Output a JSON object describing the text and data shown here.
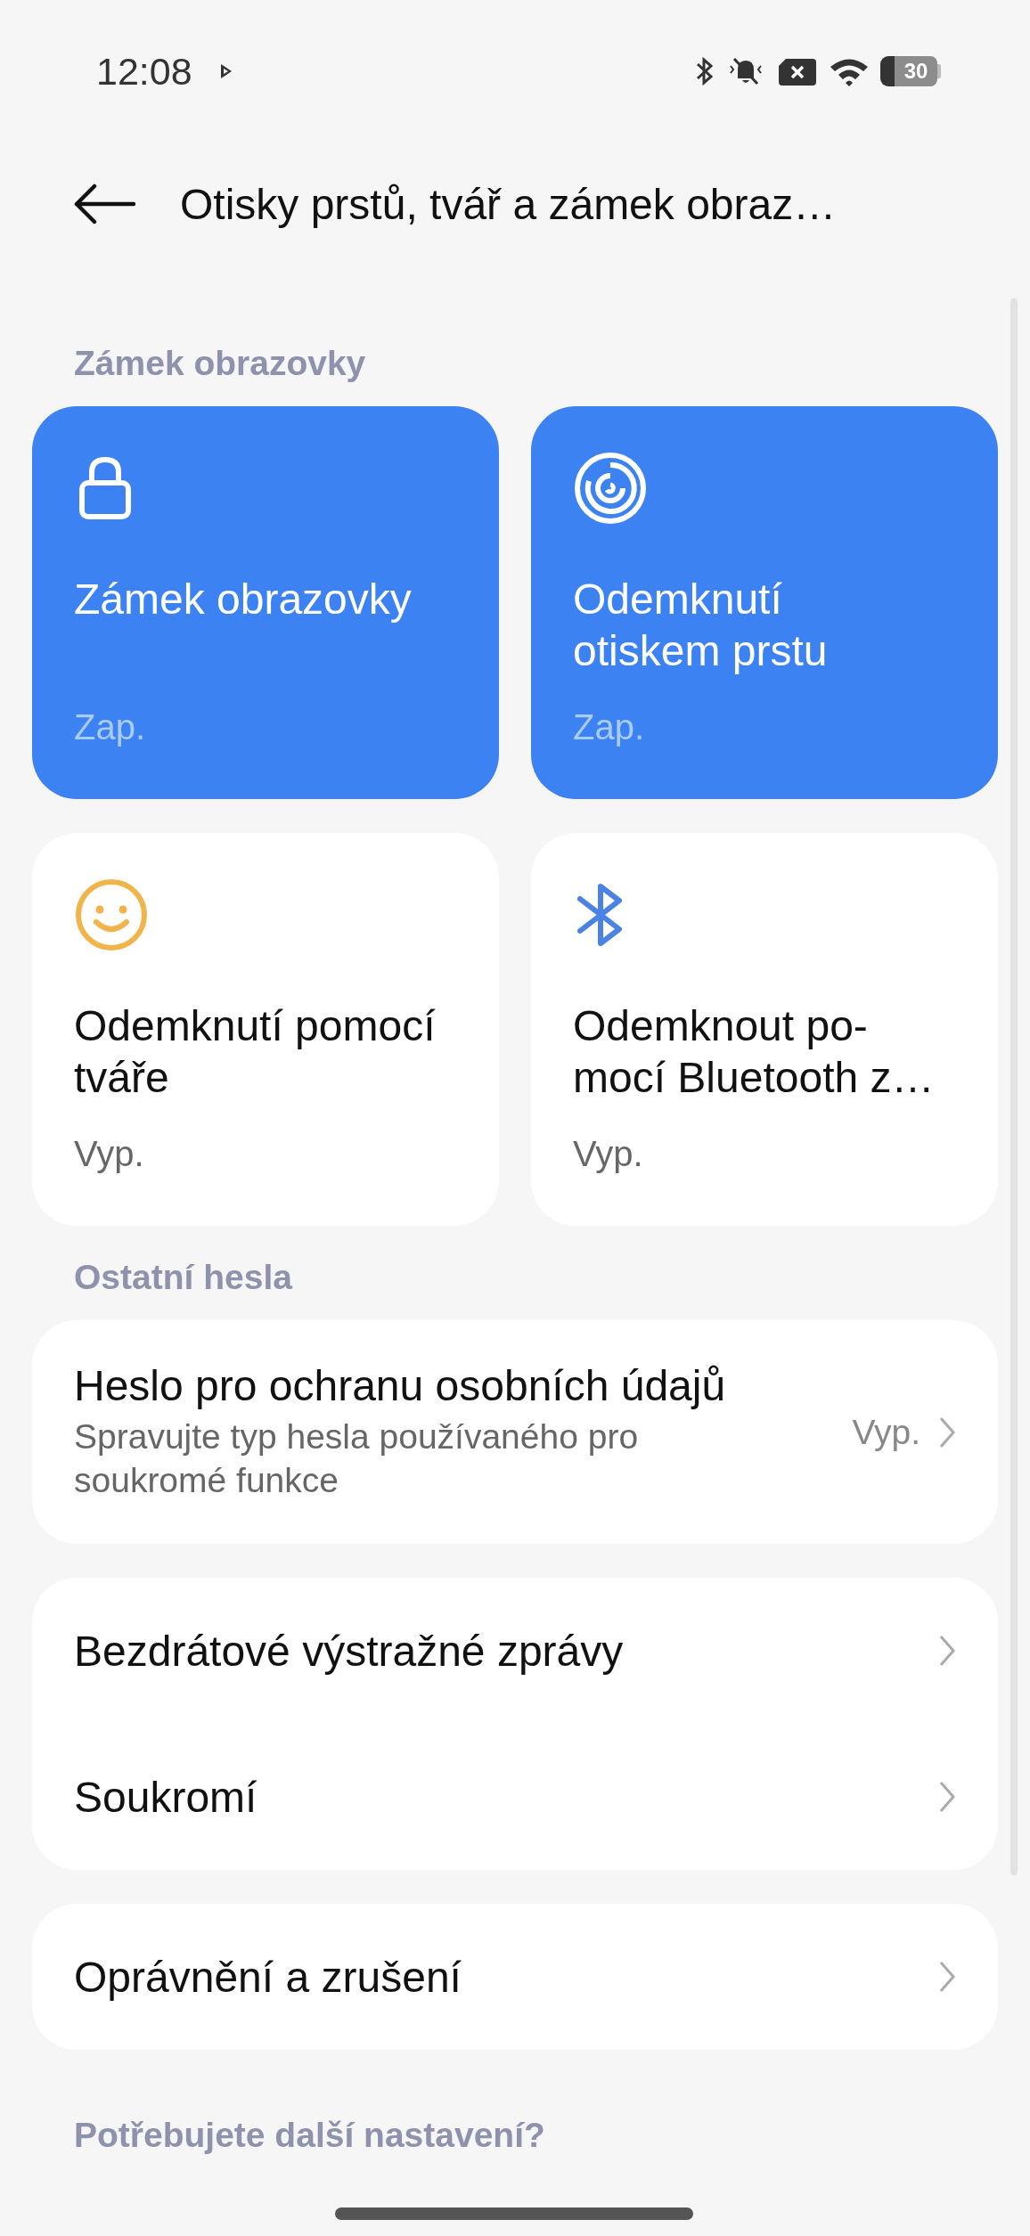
{
  "status_bar": {
    "time": "12:08",
    "battery": "30"
  },
  "header": {
    "title": "Otisky prstů, tvář a zámek obraz…"
  },
  "sections": [
    {
      "label": "Zámek obrazovky",
      "tiles": [
        {
          "kind": "lock",
          "title": "Zámek obrazovky",
          "status": "Zap.",
          "on": true
        },
        {
          "kind": "fingerprint",
          "title": "Odemknutí otiskem prstu",
          "status": "Zap.",
          "on": true
        },
        {
          "kind": "face",
          "title": "Odemknutí pomocí tváře",
          "status": "Vyp.",
          "on": false
        },
        {
          "kind": "bluetooth",
          "title": "Odemknout po-mocí Bluetooth z…",
          "status": "Vyp.",
          "on": false
        }
      ]
    },
    {
      "label": "Ostatní hesla",
      "groups": [
        [
          {
            "title": "Heslo pro ochranu osobních údajů",
            "subtitle": "Spravujte typ hesla používaného pro soukromé funkce",
            "value": "Vyp."
          }
        ],
        [
          {
            "title": "Bezdrátové výstražné zprávy"
          },
          {
            "title": "Soukromí"
          }
        ],
        [
          {
            "title": "Oprávnění a zrušení"
          }
        ]
      ]
    },
    {
      "label": "Potřebujete další nastavení?"
    }
  ]
}
